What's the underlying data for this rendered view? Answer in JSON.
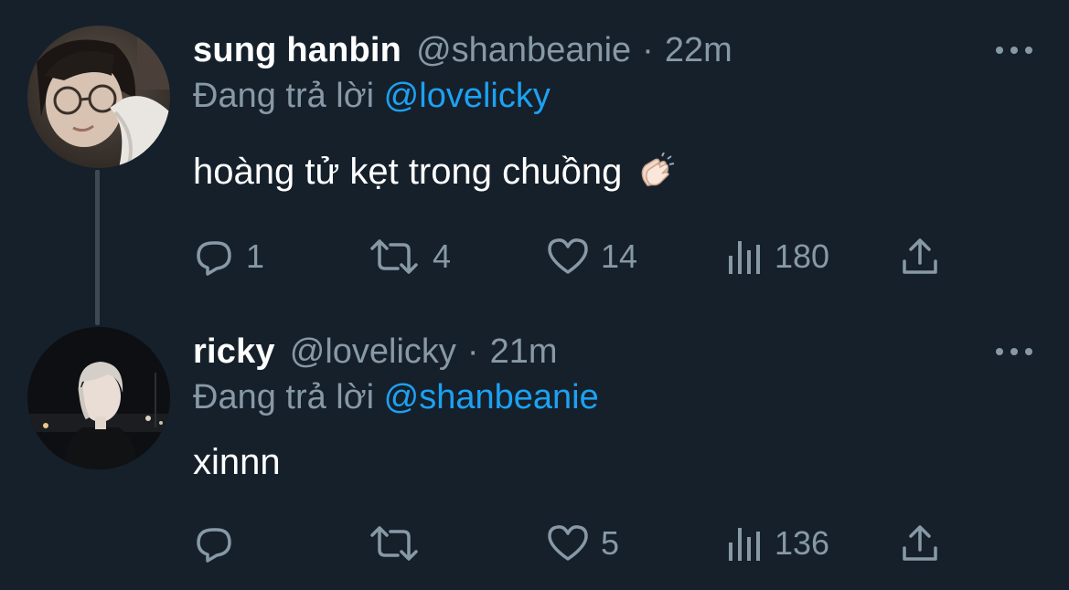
{
  "tweets": [
    {
      "name": "sung hanbin",
      "handle": "@shanbeanie",
      "separator": "·",
      "time": "22m",
      "replying_prefix": "Đang trả lời",
      "replying_to": "@lovelicky",
      "text": "hoàng tử kẹt trong chuồng",
      "emoji": "clapping-hands",
      "stats": {
        "replies": "1",
        "retweets": "4",
        "likes": "14",
        "views": "180"
      }
    },
    {
      "name": "ricky",
      "handle": "@lovelicky",
      "separator": "·",
      "time": "21m",
      "replying_prefix": "Đang trả lời",
      "replying_to": "@shanbeanie",
      "text": "xinnn",
      "stats": {
        "replies": "",
        "retweets": "",
        "likes": "5",
        "views": "136"
      }
    }
  ],
  "icons": {
    "reply": "speech-bubble-icon",
    "retweet": "retweet-icon",
    "like": "heart-icon",
    "views": "bar-chart-icon",
    "share": "share-icon",
    "more": "three-dots-icon"
  },
  "colors": {
    "background": "#15202b",
    "text": "#ffffff",
    "muted": "#8899a6",
    "link": "#1da1f2",
    "thread_line": "#3d4953"
  }
}
